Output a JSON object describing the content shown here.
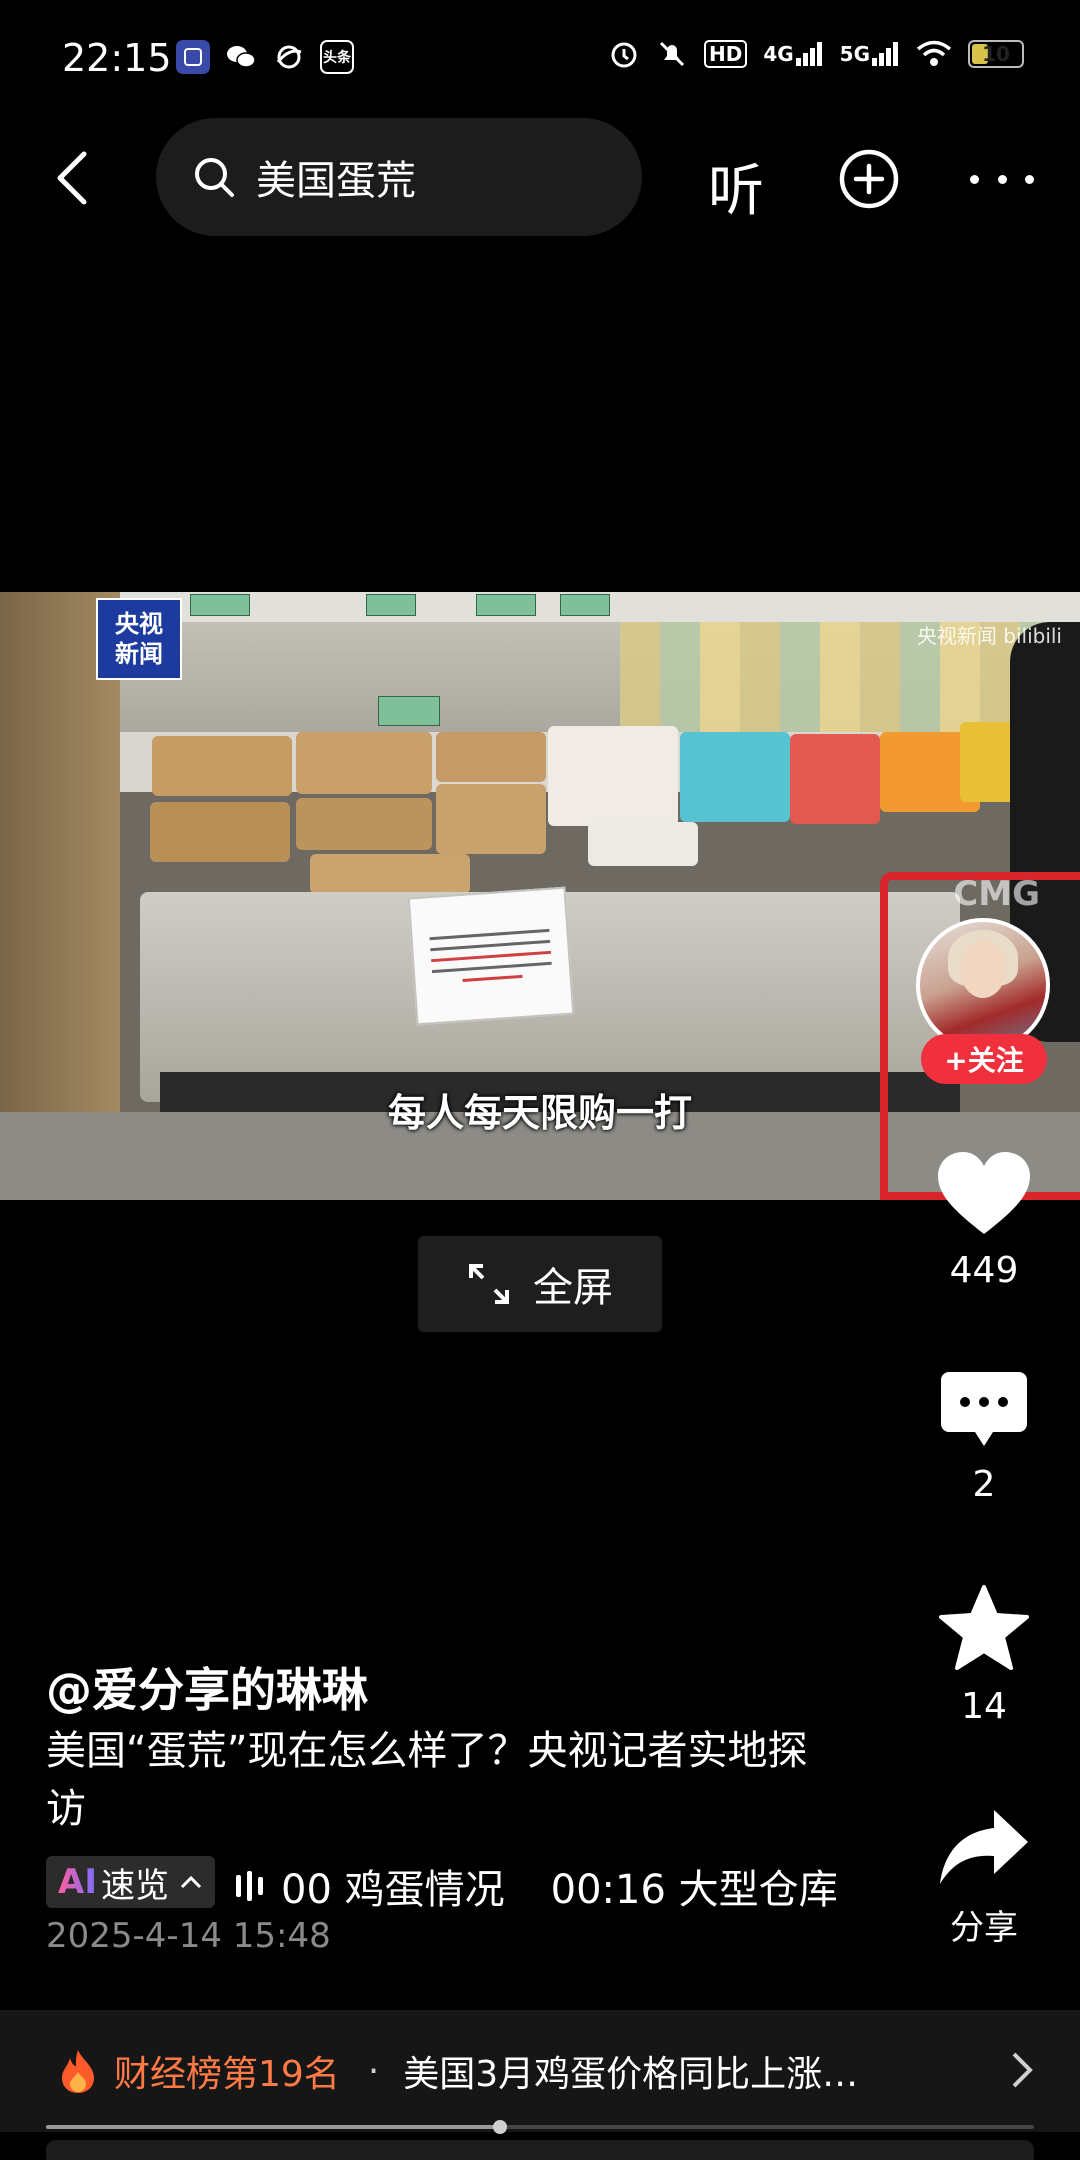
{
  "status_bar": {
    "time": "22:15",
    "app_icons": [
      "hupu-app-icon",
      "wechat-icon",
      "browser-icon",
      "toutiao-icon"
    ],
    "toutiao_label": "头条",
    "hd_label": "HD",
    "net1": "4G",
    "net2": "5G",
    "battery": "10"
  },
  "top_nav": {
    "search_text": "美国蛋荒",
    "listen_label": "听"
  },
  "video": {
    "channel_logo_line1": "央视",
    "channel_logo_line2": "新闻",
    "watermark_right": "央视新闻 bilibili",
    "watermark_cmg": "CMG",
    "subtitle": "每人每天限购一打"
  },
  "fullscreen": {
    "label": "全屏"
  },
  "actions": {
    "follow_label": "+关注",
    "likes": "449",
    "comments": "2",
    "favorites": "14",
    "share_label": "分享"
  },
  "post": {
    "author": "@爱分享的琳琳",
    "description": "美国“蛋荒”现在怎么样了？央视记者实地探访",
    "ai_badge": "AI",
    "ai_label": "速览",
    "chapters": [
      "00 鸡蛋情况",
      "00:16 大型仓库"
    ],
    "date": "2025-4-14 15:48"
  },
  "hot_bar": {
    "rank_label": "财经榜第19名",
    "separator": "·",
    "headline": "美国3月鸡蛋价格同比上涨…"
  },
  "progress": {
    "fraction": 0.46
  },
  "colors": {
    "accent_red": "#f0303d",
    "rank_orange": "#ff7a45",
    "channel_blue": "#1d3b9e"
  }
}
